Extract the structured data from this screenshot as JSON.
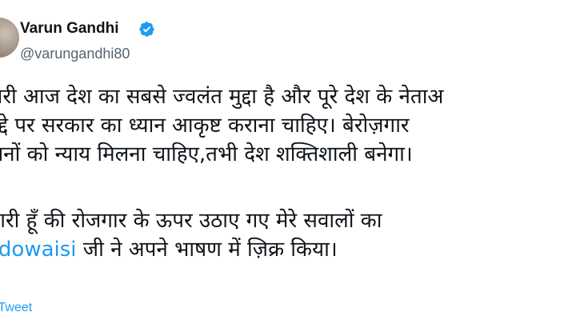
{
  "author": {
    "name": "Varun Gandhi",
    "handle": "@varungandhi80",
    "verified": true,
    "avatar_icon": "profile-photo-avatar"
  },
  "tweet": {
    "lines": [
      "गारी आज देश का सबसे ज्वलंत मुद्दा है और पूरे देश के नेताअ",
      "ुद्दे पर सरकार का ध्यान आकृष्ट कराना चाहिए। बेरोज़गार",
      "ानों को न्याय मिलना चाहिए,तभी देश शक्तिशाली बनेगा।"
    ],
    "line4": "भारी हूँ की रोजगार के ऊपर उठाए गए मेरे सवालों का",
    "mention": "adowaisi",
    "line5_rest": " जी ने अपने भाषण में ज़िक्र किया।"
  },
  "translate_label": "te Tweet",
  "colors": {
    "text": "#0f1419",
    "secondary": "#536471",
    "link": "#1d9bf0",
    "verified": "#1d9bf0"
  }
}
